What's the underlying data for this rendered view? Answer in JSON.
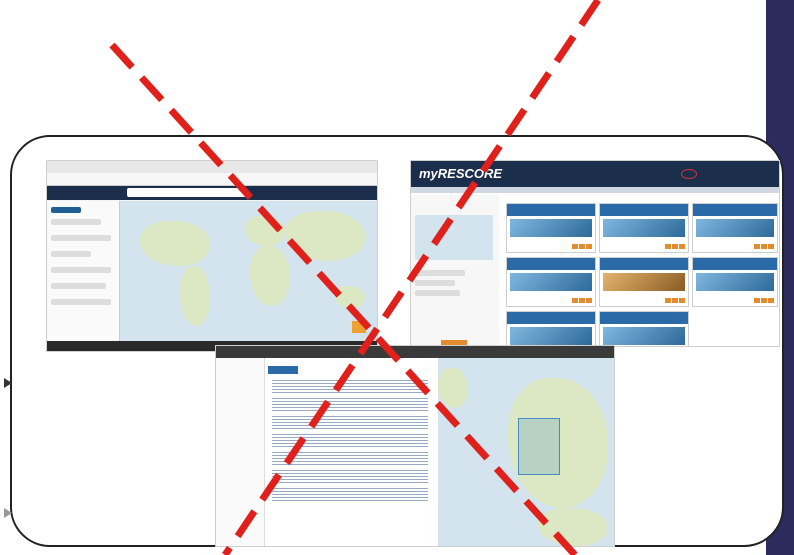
{
  "brand": {
    "logo_text": "myRESCORE"
  },
  "screen_top_left": {
    "search_placeholder": "",
    "tabs": [
      "",
      ""
    ]
  },
  "screen_top_right": {
    "cards": [
      {
        "title": ""
      },
      {
        "title": ""
      },
      {
        "title": ""
      },
      {
        "title": ""
      },
      {
        "title": ""
      },
      {
        "title": ""
      },
      {
        "title": ""
      },
      {
        "title": ""
      }
    ]
  },
  "screen_bottom": {
    "header_title": "",
    "results": 6
  },
  "colors": {
    "cross": "#e0201b",
    "strip": "#2d2a5e",
    "rescore_header": "#1b2f4d"
  }
}
